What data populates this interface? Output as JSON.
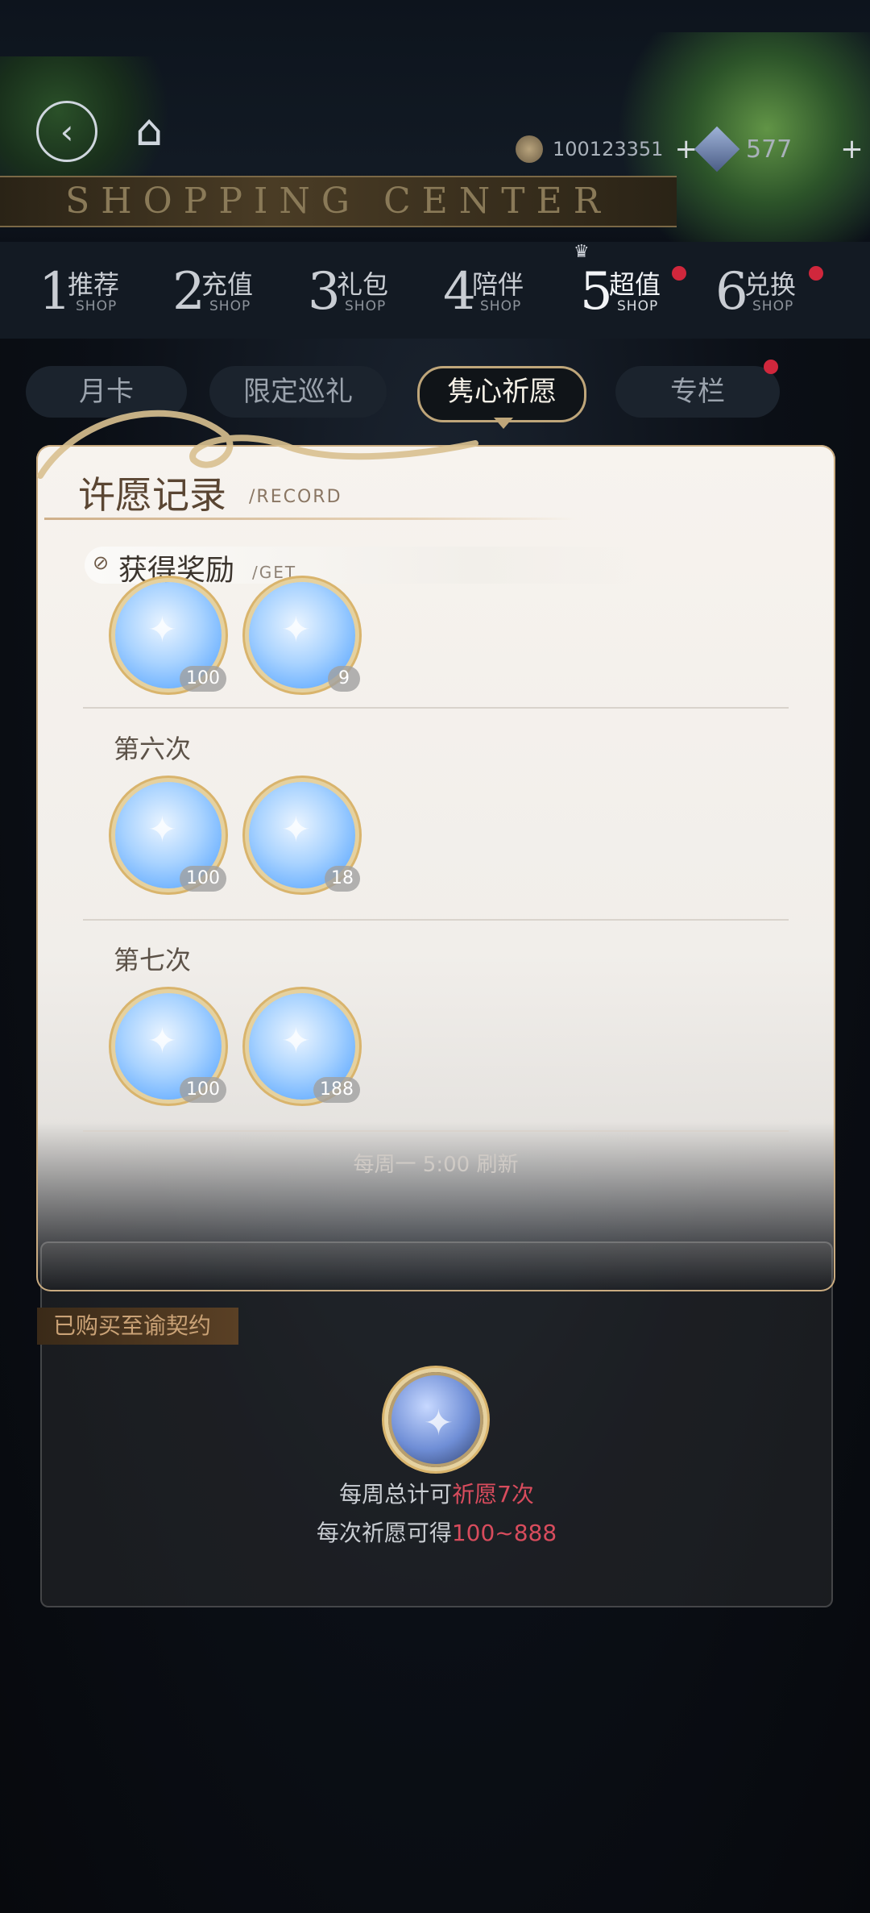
{
  "header": {
    "banner_title": "SHOPPING CENTER",
    "currency": [
      {
        "icon": "coin-icon",
        "value": "100123351"
      },
      {
        "icon": "gem-icon",
        "value": "577"
      }
    ]
  },
  "tabs": [
    {
      "num": "1",
      "label": "推荐",
      "en": "SHOP",
      "badge": false,
      "active": false
    },
    {
      "num": "2",
      "label": "充值",
      "en": "SHOP",
      "badge": false,
      "active": false
    },
    {
      "num": "3",
      "label": "礼包",
      "en": "SHOP",
      "badge": false,
      "active": false
    },
    {
      "num": "4",
      "label": "陪伴",
      "en": "SHOP",
      "badge": false,
      "active": false
    },
    {
      "num": "5",
      "label": "超值",
      "en": "SHOP",
      "badge": true,
      "active": true
    },
    {
      "num": "6",
      "label": "兑换",
      "en": "SHOP",
      "badge": true,
      "active": false
    }
  ],
  "subtabs": [
    "月卡",
    "限定巡礼",
    "隽心祈愿",
    "专栏"
  ],
  "modal": {
    "title_zh": "许愿记录",
    "title_en": "/RECORD",
    "get_zh": "获得奖励",
    "get_en": "/GET",
    "sections": [
      {
        "label": "",
        "coins": [
          "100",
          "9"
        ]
      },
      {
        "label": "第六次",
        "coins": [
          "100",
          "18"
        ]
      },
      {
        "label": "第七次",
        "coins": [
          "100",
          "188"
        ]
      }
    ],
    "faded_line": "每周一 5:00 刷新"
  },
  "background_panel": {
    "bought_label": "已购买至谕契约",
    "line1_prefix": "每周总计可",
    "line1_highlight": "祈愿7次",
    "line2_prefix": "每次祈愿可得",
    "line2_highlight": "100~888"
  },
  "colors": {
    "accent_gold": "#bfa67a",
    "badge_red": "#d0273c",
    "highlight_red": "#d84c5d"
  }
}
